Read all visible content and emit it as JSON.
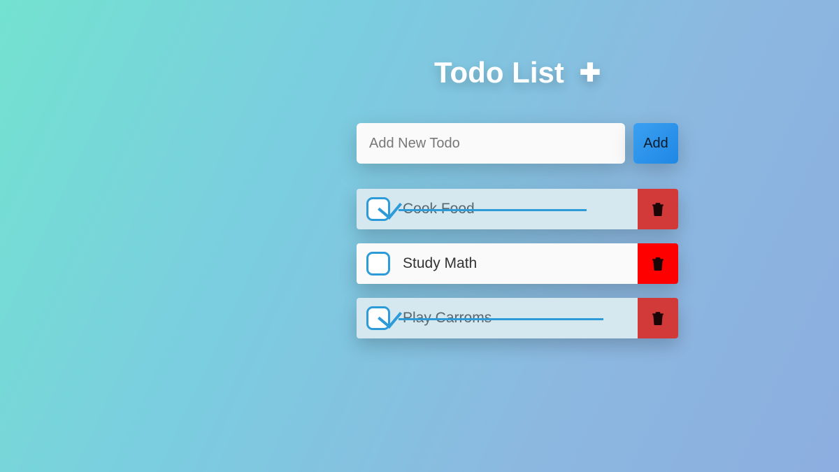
{
  "header": {
    "title": "Todo List",
    "plus_icon": "plus-icon"
  },
  "input": {
    "placeholder": "Add New Todo",
    "value": "",
    "add_label": "Add"
  },
  "todos": [
    {
      "text": "Cook Food",
      "completed": true
    },
    {
      "text": "Study Math",
      "completed": false
    },
    {
      "text": "Play Carroms",
      "completed": true
    }
  ]
}
